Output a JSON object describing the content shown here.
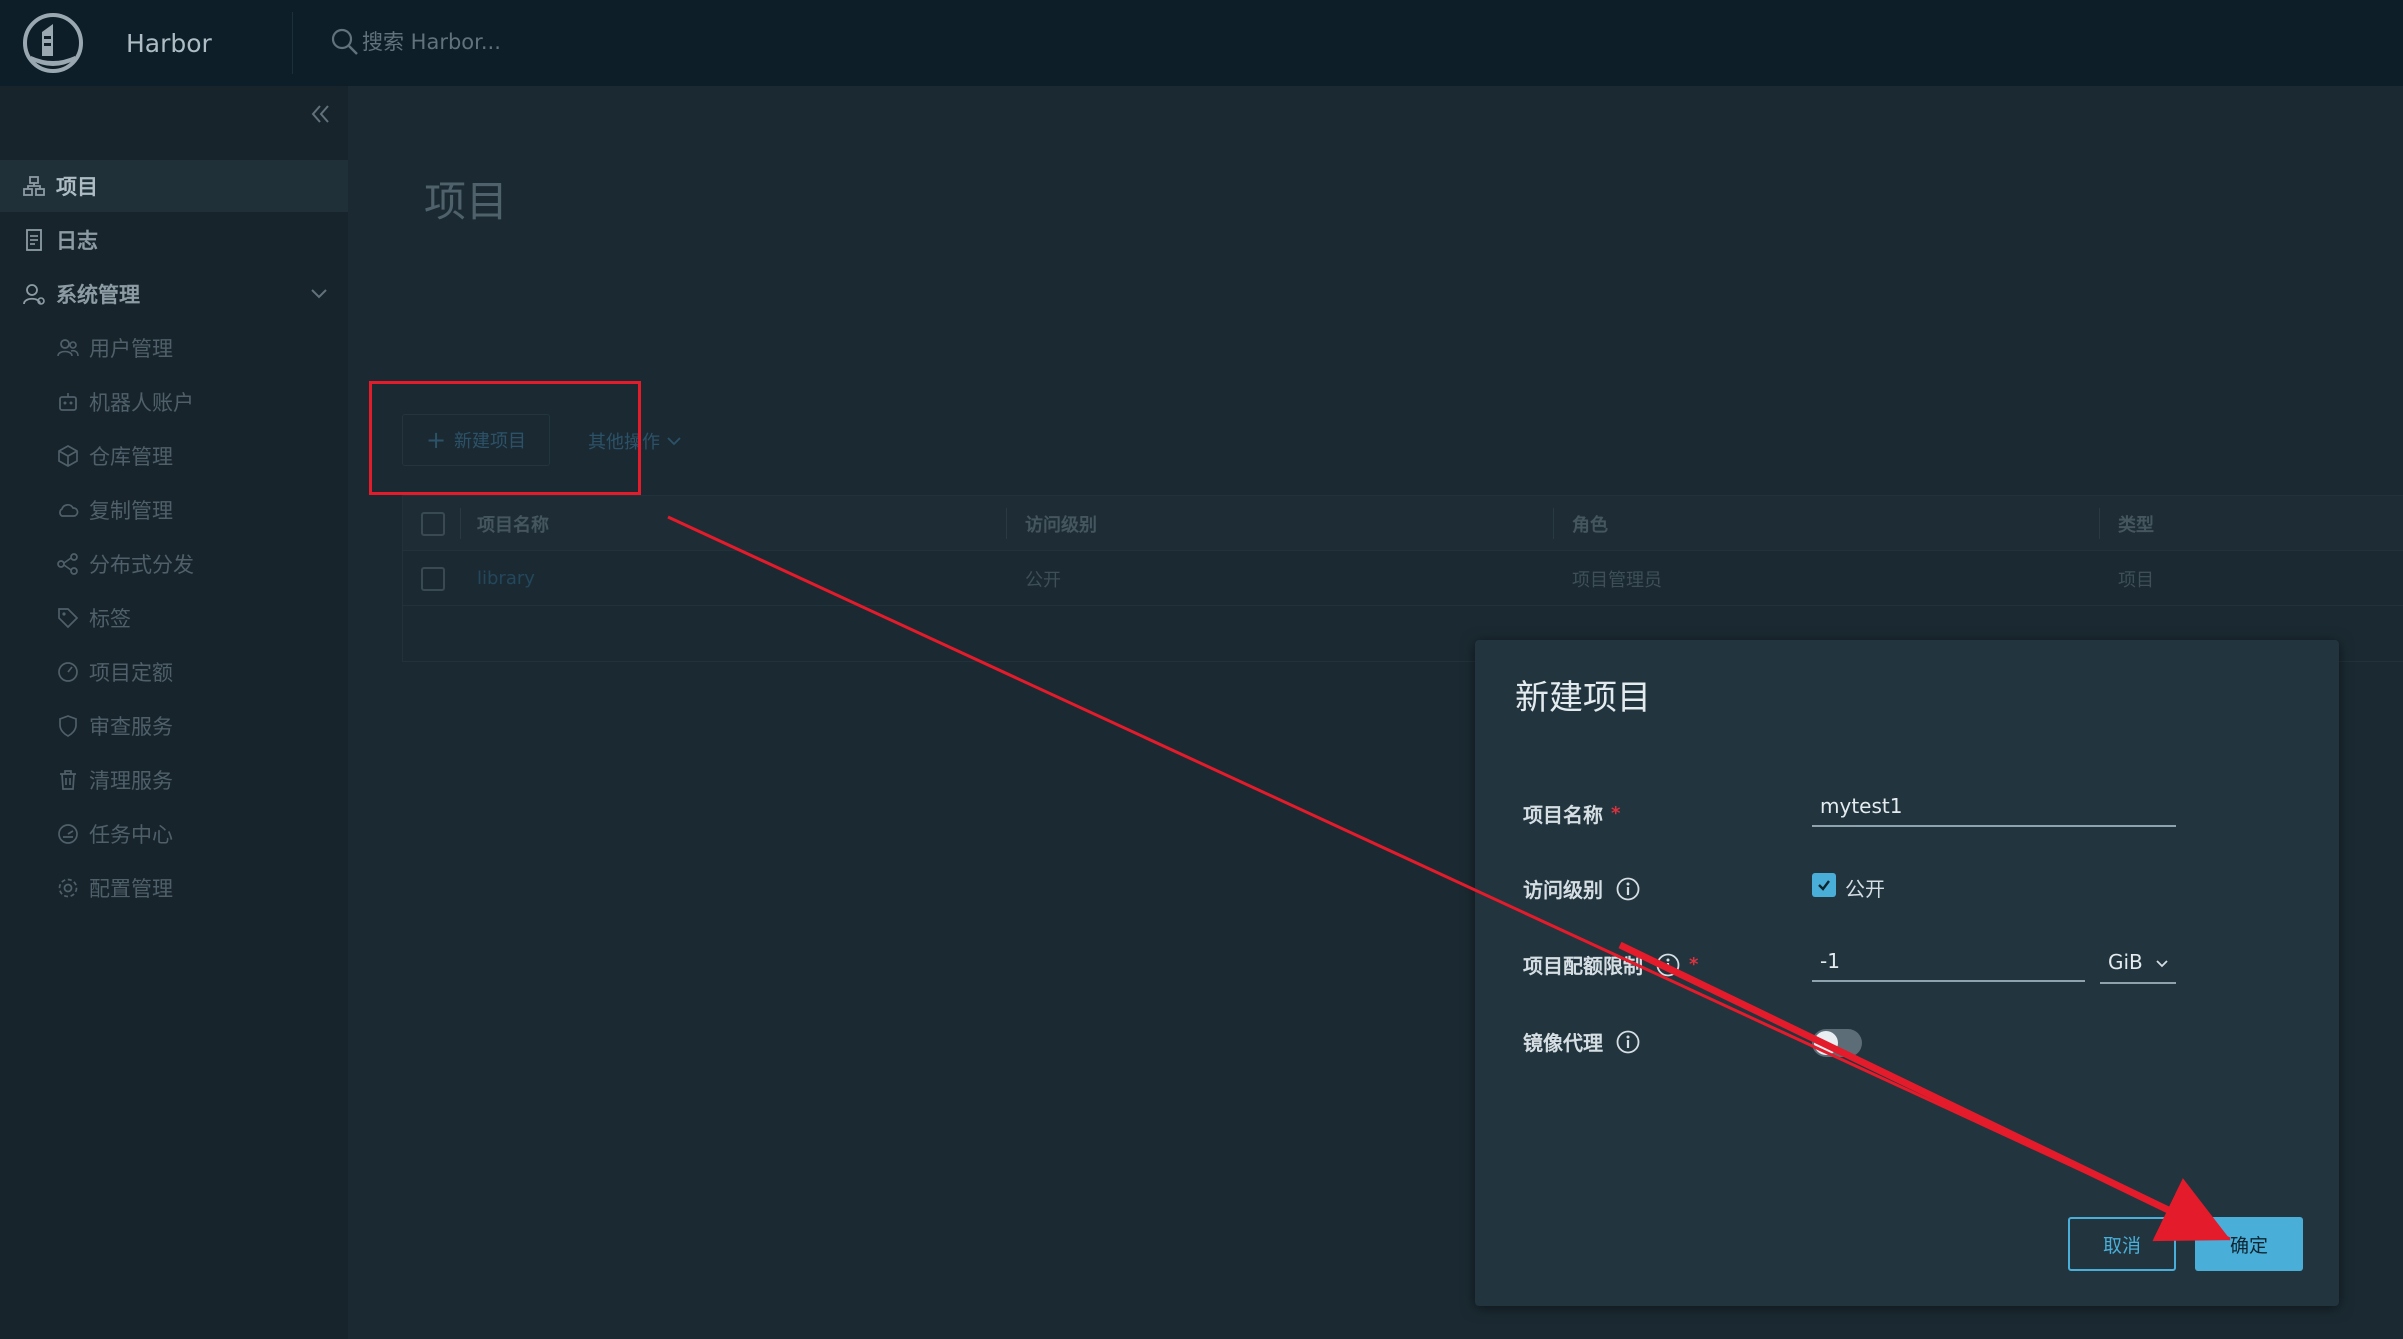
{
  "header": {
    "app_name": "Harbor",
    "search_placeholder": "搜索 Harbor..."
  },
  "sidebar": {
    "items": [
      {
        "label": "项目",
        "icon": "projects-icon",
        "active": true
      },
      {
        "label": "日志",
        "icon": "logs-icon"
      },
      {
        "label": "系统管理",
        "icon": "admin-icon",
        "expanded": true
      }
    ],
    "sub_items": [
      {
        "label": "用户管理",
        "icon": "users-icon"
      },
      {
        "label": "机器人账户",
        "icon": "robot-icon"
      },
      {
        "label": "仓库管理",
        "icon": "registry-icon"
      },
      {
        "label": "复制管理",
        "icon": "replication-icon"
      },
      {
        "label": "分布式分发",
        "icon": "share-icon"
      },
      {
        "label": "标签",
        "icon": "tag-icon"
      },
      {
        "label": "项目定额",
        "icon": "quota-icon"
      },
      {
        "label": "审查服务",
        "icon": "shield-icon"
      },
      {
        "label": "清理服务",
        "icon": "trash-icon"
      },
      {
        "label": "任务中心",
        "icon": "dashboard-icon"
      },
      {
        "label": "配置管理",
        "icon": "gear-icon"
      }
    ]
  },
  "main": {
    "title": "项目",
    "new_project_label": "新建项目",
    "other_actions_label": "其他操作",
    "table": {
      "columns": [
        "项目名称",
        "访问级别",
        "角色",
        "类型"
      ],
      "rows": [
        {
          "name": "library",
          "access": "公开",
          "role": "项目管理员",
          "type": "项目"
        }
      ]
    }
  },
  "modal": {
    "title": "新建项目",
    "name_label": "项目名称",
    "name_value": "mytest1",
    "required_mark": "*",
    "access_label": "访问级别",
    "public_label": "公开",
    "public_checked": true,
    "quota_label": "项目配额限制",
    "quota_value": "-1",
    "quota_unit": "GiB",
    "proxy_label": "镜像代理",
    "proxy_enabled": false,
    "cancel_label": "取消",
    "ok_label": "确定"
  },
  "colors": {
    "header_bg": "#0e1e29",
    "sidebar_bg": "#17242c",
    "content_bg": "#1b2a32",
    "modal_bg": "#22343e",
    "primary": "#49afd9",
    "annotation": "#e41b2b"
  }
}
